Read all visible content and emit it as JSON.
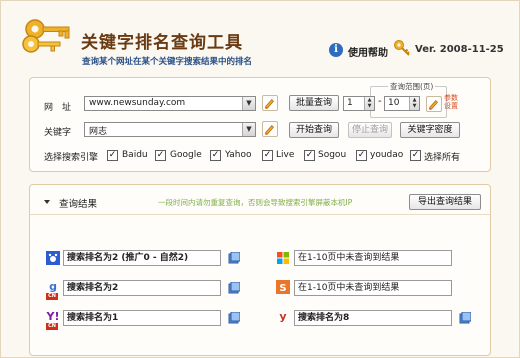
{
  "header": {
    "title": "关键字排名查询工具",
    "subtitle": "查询某个网址在某个关键字搜索结果中的排名",
    "help_label": "使用帮助",
    "version": "Ver. 2008-11-25"
  },
  "form": {
    "url_label": "网　址",
    "url_value": "www.newsunday.com",
    "batch_button": "批量查询",
    "range_title": "查询范围(页)",
    "range_from": "1",
    "range_to": "10",
    "param_label": "参数设置",
    "keyword_label": "关键字",
    "keyword_value": "网志",
    "start_button": "开始查询",
    "stop_button": "停止查询",
    "density_button": "关键字密度",
    "engines_label": "选择搜索引擎",
    "engines": [
      {
        "label": "Baidu",
        "checked": true
      },
      {
        "label": "Google",
        "checked": true
      },
      {
        "label": "Yahoo",
        "checked": true
      },
      {
        "label": "Live",
        "checked": true
      },
      {
        "label": "Sogou",
        "checked": true
      },
      {
        "label": "youdao",
        "checked": true
      },
      {
        "label": "选择所有",
        "checked": true
      }
    ]
  },
  "results": {
    "title": "查询结果",
    "tip": "一段时间内请勿重复查询，否则会导致搜索引擎屏蔽本机IP",
    "export_button": "导出查询结果",
    "rows": [
      {
        "icon": "baidu-icon",
        "text": "搜索排名为2 (推广0 - 自然2)"
      },
      {
        "icon": "live-icon",
        "text": "在1-10页中未查询到结果"
      },
      {
        "icon": "google-cn-icon",
        "text": "搜索排名为2"
      },
      {
        "icon": "sogou-icon",
        "text": "在1-10页中未查询到结果"
      },
      {
        "icon": "yahoo-cn-icon",
        "text": "搜索排名为1"
      },
      {
        "icon": "youdao-icon",
        "text": "搜索排名为8"
      }
    ]
  },
  "colors": {
    "title_brown": "#6a3b12",
    "subtitle_blue": "#2a4f86",
    "tip_green": "#7fae47",
    "panel_border": "#e1caa5"
  }
}
